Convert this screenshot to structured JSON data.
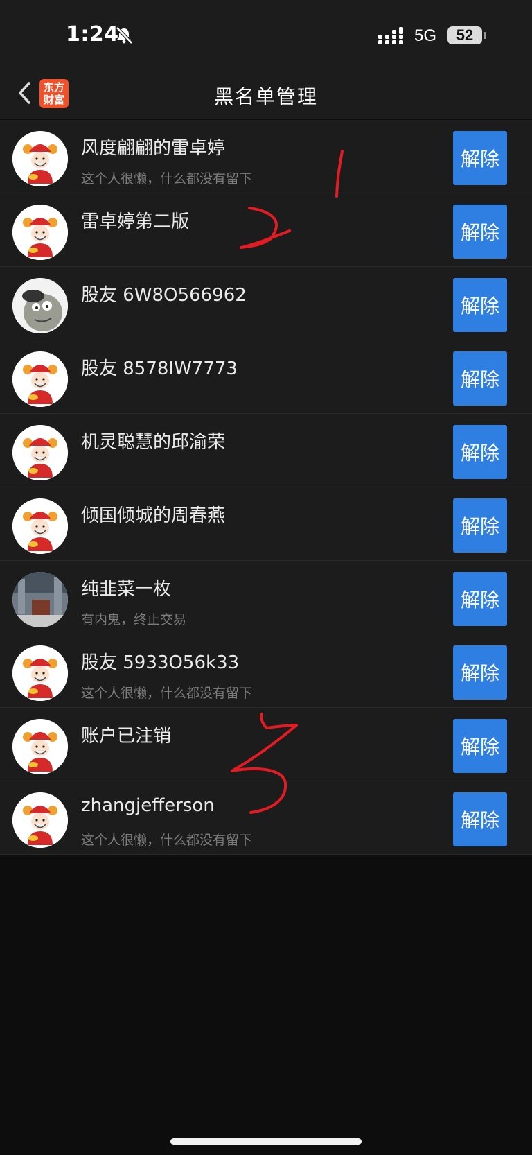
{
  "status_bar": {
    "time": "1:24",
    "network": "5G",
    "battery": "52"
  },
  "header": {
    "title": "黑名单管理",
    "logo_line1": "东方",
    "logo_line2": "财富"
  },
  "button_label": "解除",
  "rows": [
    {
      "name": "风度翩翩的雷卓婷",
      "bio": "这个人很懒，什么都没有留下",
      "avatar": "god-of-wealth-avatar"
    },
    {
      "name": "雷卓婷第二版",
      "bio": "",
      "avatar": "god-of-wealth-avatar"
    },
    {
      "name": "股友 6W8O566962",
      "bio": "",
      "avatar": "zombie-avatar"
    },
    {
      "name": "股友 8578IW7773",
      "bio": "",
      "avatar": "god-of-wealth-avatar"
    },
    {
      "name": "机灵聪慧的邱渝荣",
      "bio": "",
      "avatar": "god-of-wealth-avatar"
    },
    {
      "name": "倾国倾城的周春燕",
      "bio": "",
      "avatar": "god-of-wealth-avatar"
    },
    {
      "name": "纯韭菜一枚",
      "bio": "有内鬼，终止交易",
      "avatar": "photo-avatar"
    },
    {
      "name": "股友 5933O56k33",
      "bio": "这个人很懒，什么都没有留下",
      "avatar": "god-of-wealth-avatar"
    },
    {
      "name": "账户已注销",
      "bio": "",
      "avatar": "god-of-wealth-avatar"
    },
    {
      "name": "zhangjefferson",
      "bio": "这个人很懒，什么都没有留下",
      "avatar": "god-of-wealth-avatar"
    }
  ],
  "annotations": [
    "1",
    "2",
    "3"
  ],
  "colors": {
    "accent": "#2f7fe3",
    "background": "#1c1c1c",
    "annotation": "#e31b23",
    "logo": "#f0512a"
  }
}
